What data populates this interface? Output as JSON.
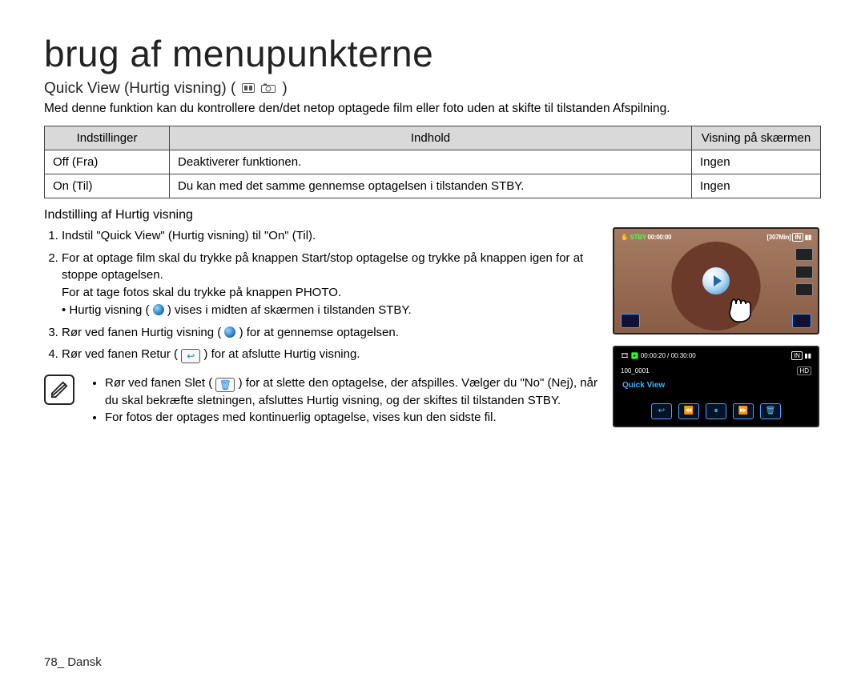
{
  "title": "brug af menupunkterne",
  "subtitle": "Quick View (Hurtig visning) (",
  "subtitle_close": ")",
  "subtitle_icons": {
    "film": "film-icon",
    "camera": "camera-icon"
  },
  "intro": "Med denne funktion kan du kontrollere den/det netop optagede film eller foto uden at skifte til tilstanden Afspilning.",
  "table": {
    "headers": {
      "c1": "Indstillinger",
      "c2": "Indhold",
      "c3": "Visning på skærmen"
    },
    "rows": [
      {
        "c1": "Off (Fra)",
        "c2": "Deaktiverer funktionen.",
        "c3": "Ingen"
      },
      {
        "c1": "On (Til)",
        "c2": "Du kan med det samme gennemse optagelsen i tilstanden STBY.",
        "c3": "Ingen"
      }
    ]
  },
  "steps_heading": "Indstilling af Hurtig visning",
  "steps": {
    "s1": "Indstil \"Quick View\" (Hurtig visning) til \"On\" (Til).",
    "s2a": "For at optage film skal du trykke på knappen Start/stop optagelse og trykke på knappen igen for at stoppe optagelsen.",
    "s2b": "For at tage fotos skal du trykke på knappen PHOTO.",
    "s2c_pre": "Hurtig visning (",
    "s2c_post": ") vises i midten af skærmen i tilstanden STBY.",
    "s3_pre": "Rør ved fanen Hurtig visning (",
    "s3_post": ") for at gennemse optagelsen.",
    "s4_pre": "Rør ved fanen Retur (",
    "s4_post": ") for at afslutte Hurtig visning."
  },
  "notes": {
    "n1_pre": "Rør ved fanen Slet (",
    "n1_post": ") for at slette den optagelse, der afspilles.",
    "n1b": "Vælger du \"No\" (Nej), når du skal bekræfte sletningen, afsluttes Hurtig visning, og der skiftes til tilstanden STBY.",
    "n2": "For fotos der optages med kontinuerlig optagelse, vises kun den sidste fil."
  },
  "screen1": {
    "stby": "STBY",
    "time": "00:00:00",
    "remain": "[307Min]",
    "in": "IN"
  },
  "screen2": {
    "clock": "00:00:20 / 00:30:00",
    "in": "IN",
    "clip": "100_0001",
    "label": "Quick View"
  },
  "footer_page": "78",
  "footer_lang": "Dansk",
  "icons": {
    "return": "↩",
    "trash": "🗑"
  }
}
